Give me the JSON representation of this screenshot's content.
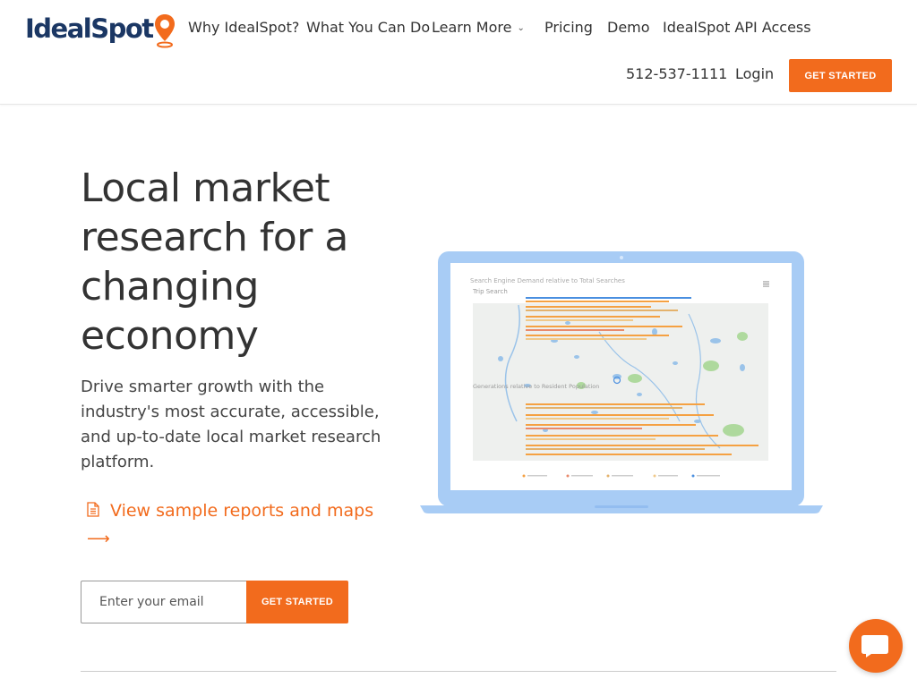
{
  "header": {
    "logo_text": "IdealSpot",
    "nav": [
      {
        "label": "Why IdealSpot?"
      },
      {
        "label": "What You Can Do"
      },
      {
        "label": "Learn More",
        "has_dropdown": true
      },
      {
        "label": "Pricing"
      },
      {
        "label": "Demo"
      },
      {
        "label": "IdealSpot API Access"
      }
    ],
    "phone": "512-537-1111",
    "login": "Login",
    "cta": "GET STARTED"
  },
  "hero": {
    "title": "Local market research for a changing economy",
    "subtitle": "Drive smarter growth with the industry's most accurate, accessible, and up-to-date local market research platform.",
    "sample_link": "View sample reports and maps",
    "arrow": "⟶",
    "email_placeholder": "Enter your email",
    "email_value": "",
    "email_cta": "GET STARTED"
  },
  "screen": {
    "chart_title_1": "Search Engine Demand relative to Total Searches",
    "chart_title_2": "Trip Search",
    "chart_title_3": "Generations relative to Resident Population"
  },
  "colors": {
    "accent": "#f26b1d",
    "brand_navy": "#1b3764",
    "laptop": "#a8ccf5"
  }
}
